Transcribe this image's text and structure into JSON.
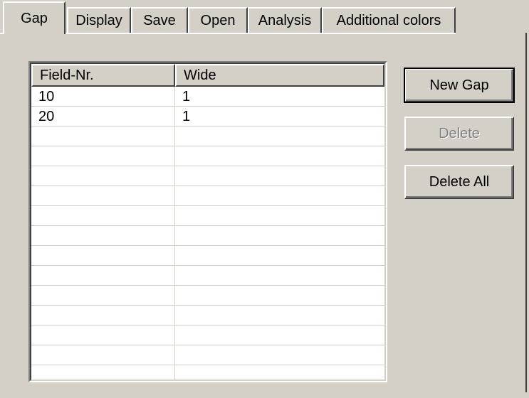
{
  "tabs": [
    {
      "label": "Gap",
      "active": true
    },
    {
      "label": "Display",
      "active": false
    },
    {
      "label": "Save",
      "active": false
    },
    {
      "label": "Open",
      "active": false
    },
    {
      "label": "Analysis",
      "active": false
    },
    {
      "label": "Additional colors",
      "active": false
    }
  ],
  "table": {
    "columns": [
      "Field-Nr.",
      "Wide"
    ],
    "rows": [
      [
        "10",
        "1"
      ],
      [
        "20",
        "1"
      ]
    ]
  },
  "buttons": {
    "new_gap": "New Gap",
    "delete": "Delete",
    "delete_all": "Delete All"
  }
}
